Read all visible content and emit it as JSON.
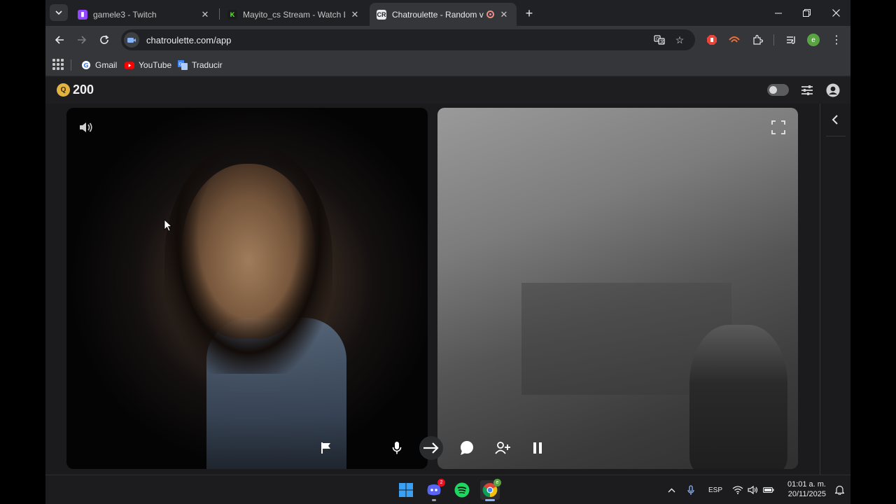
{
  "browser": {
    "tabs": [
      {
        "title": "gamele3 - Twitch",
        "favicon": "twitch-icon",
        "color": "#9146ff",
        "active": false
      },
      {
        "title": "Mayito_cs Stream - Watch Live",
        "favicon": "kick-icon",
        "color": "#53fc18",
        "active": false
      },
      {
        "title": "Chatroulette - Random vide",
        "favicon": "chatroulette-icon",
        "color": "#e8eaed",
        "active": true
      }
    ],
    "url": "chatroulette.com/app",
    "bookmarks": [
      {
        "label": "Gmail",
        "icon": "google-icon"
      },
      {
        "label": "YouTube",
        "icon": "youtube-icon"
      },
      {
        "label": "Traducir",
        "icon": "translate-icon"
      }
    ],
    "profile_initial": "e"
  },
  "app": {
    "coins": "200",
    "accent": "#e2b33f"
  },
  "taskbar": {
    "discord_badge": "2",
    "language": "ESP",
    "time": "01:01 a. m.",
    "date": "20/11/2025"
  }
}
